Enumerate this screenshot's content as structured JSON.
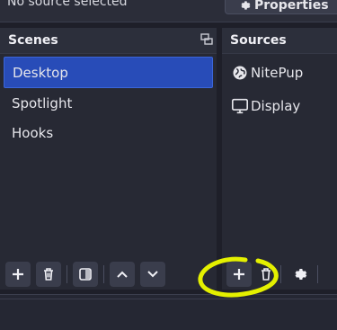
{
  "top": {
    "no_source": "No source selected",
    "properties_label": "Properties"
  },
  "scenes": {
    "title": "Scenes",
    "items": [
      {
        "label": "Desktop",
        "selected": true
      },
      {
        "label": "Spotlight",
        "selected": false
      },
      {
        "label": "Hooks",
        "selected": false
      }
    ]
  },
  "sources": {
    "title": "Sources",
    "items": [
      {
        "label": "NitePup",
        "icon": "globe-icon"
      },
      {
        "label": "Display",
        "icon": "monitor-icon"
      }
    ]
  },
  "toolbar": {
    "scenes_buttons": [
      "add-icon",
      "trash-icon",
      "filter-icon",
      "chevron-up-icon",
      "chevron-down-icon"
    ],
    "sources_buttons": [
      "add-icon",
      "trash-icon",
      "gear-icon"
    ]
  },
  "colors": {
    "selected": "#284cb8",
    "highlight": "#e4f000",
    "panel": "#272934"
  }
}
